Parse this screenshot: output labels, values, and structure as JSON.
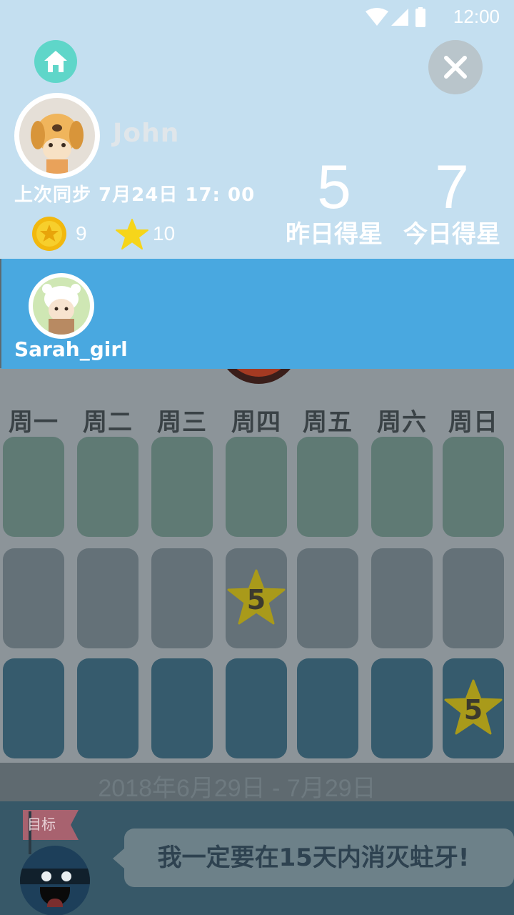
{
  "status_bar": {
    "time": "12:00"
  },
  "profile": {
    "username": "John",
    "last_sync": "上次同步 7月24日 17: 00",
    "coins": "9",
    "stars": "10"
  },
  "stats": {
    "yesterday_value": "5",
    "yesterday_label": "昨日得星",
    "today_value": "7",
    "today_label": "今日得星"
  },
  "child": {
    "name": "Sarah_girl"
  },
  "calendar": {
    "weekdays": [
      "周一",
      "周二",
      "周三",
      "周四",
      "周五",
      "周六",
      "周日"
    ],
    "rows": [
      [
        "",
        "",
        "",
        "",
        "",
        "",
        ""
      ],
      [
        "",
        "",
        "",
        "5",
        "",
        "",
        ""
      ],
      [
        "",
        "",
        "",
        "",
        "",
        "",
        "5"
      ]
    ],
    "date_range": "2018年6月29日 - 7月29日"
  },
  "goal": {
    "flag_label": "目标",
    "text": "我一定要在15天内消灭蛀牙!"
  },
  "colors": {
    "panel": "#c4dff0",
    "child_bar": "#49a8e0",
    "home_button": "#5fd6c9",
    "star": "#f6d51a"
  },
  "icons": [
    "home-icon",
    "close-icon",
    "coin-icon",
    "star-icon",
    "wifi-icon",
    "signal-icon",
    "battery-icon"
  ]
}
